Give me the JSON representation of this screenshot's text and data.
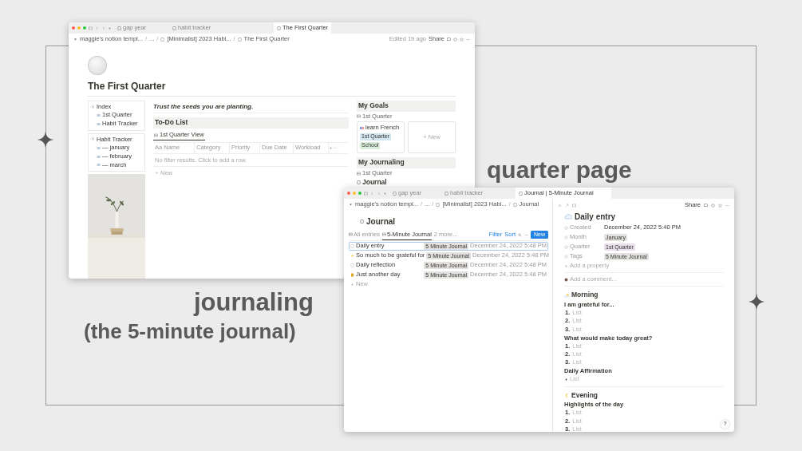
{
  "captions": [
    {
      "text": "quarter page"
    },
    {
      "text": "journaling"
    },
    {
      "text": "(the 5-minute journal)"
    }
  ],
  "quarter_window": {
    "tabs": [
      {
        "label": "gap year",
        "selected": false
      },
      {
        "label": "habit tracker",
        "selected": false
      },
      {
        "label": "The First Quarter",
        "selected": true
      }
    ],
    "breadcrumbs": [
      "maggie's notion templ...",
      "...",
      "[Minimalist] 2023 Habi...",
      "The First Quarter"
    ],
    "separator": "/",
    "edited": "Edited 1h ago",
    "share": "Share",
    "title": "The First Quarter",
    "sidebar": [
      {
        "title": "Index",
        "items": [
          "1st Quarter",
          "Habit Tracker"
        ]
      },
      {
        "title": "Habit Tracker",
        "items": [
          "— january",
          "— february",
          "— march"
        ]
      }
    ],
    "quote": "Trust the seeds you are planting.",
    "todo": {
      "title": "To-Do List",
      "view": "1st Quarter View",
      "columns": [
        "Aa Name",
        "Category",
        "Priority",
        "Due Date",
        "Workload"
      ],
      "empty": "No filter results. Click to add a row.",
      "new": "New"
    },
    "goals": {
      "title": "My Goals",
      "view": "1st Quarter",
      "cards": [
        {
          "title": "learn French",
          "tags": [
            {
              "label": "1st Quarter",
              "color": "#d3e5ef"
            },
            {
              "label": "School",
              "color": "#dbeddb"
            }
          ]
        }
      ],
      "new": "+ New"
    },
    "journaling": {
      "title": "My Journaling",
      "view": "1st Quarter",
      "database": "Journal"
    }
  },
  "journal_window": {
    "tabs": [
      {
        "label": "gap year",
        "selected": false
      },
      {
        "label": "habit tracker",
        "selected": false
      },
      {
        "label": "Journal | 5-Minute Journal",
        "selected": true
      }
    ],
    "breadcrumbs": [
      "maggie's notion templ...",
      "...",
      "[Minimalist] 2023 Habi...",
      "Journal"
    ],
    "separator": "/",
    "title": "Journal",
    "views": [
      {
        "label": "All entries",
        "selected": false
      },
      {
        "label": "5-Minute Journal",
        "selected": true
      },
      {
        "label": "2 more...",
        "selected": false
      }
    ],
    "actions": [
      "Filter",
      "Sort"
    ],
    "new": "New",
    "rows": [
      {
        "name": "Daily entry",
        "tag": "5 Minute Journal",
        "date": "December 24, 2022 5:48 PM",
        "selected": true
      },
      {
        "name": "So much to be grateful for",
        "tag": "5 Minute Journal",
        "date": "December 24, 2022 5:48 PM",
        "selected": false
      },
      {
        "name": "Daily reflection",
        "tag": "5 Minute Journal",
        "date": "December 24, 2022 5:48 PM",
        "selected": false
      },
      {
        "name": "Just another day",
        "tag": "5 Minute Journal",
        "date": "December 24, 2022 5:48 PM",
        "selected": false
      }
    ],
    "add_row": "New",
    "entry": {
      "share": "Share",
      "title": "Daily entry",
      "properties": [
        {
          "name": "Created",
          "kind": "text",
          "value": "December 24, 2022 5:40 PM"
        },
        {
          "name": "Month",
          "kind": "tag",
          "value": "January",
          "color": "#e3e2e0"
        },
        {
          "name": "Quarter",
          "kind": "tag",
          "value": "1st Quarter",
          "color": "#e8deee"
        },
        {
          "name": "Tags",
          "kind": "tag",
          "value": "5 Minute Journal",
          "color": "#e3e2e0"
        }
      ],
      "add_property": "Add a property",
      "comment_placeholder": "Add a comment...",
      "sections": [
        {
          "title": "Morning",
          "kind": "day",
          "blocks": [
            {
              "heading": "I am grateful for...",
              "kind": "numbered",
              "items": [
                {
                  "marker": "1.",
                  "text": "List"
                },
                {
                  "marker": "2.",
                  "text": "List"
                },
                {
                  "marker": "3.",
                  "text": "List"
                }
              ]
            },
            {
              "heading": "What would make today great?",
              "kind": "numbered",
              "items": [
                {
                  "marker": "1.",
                  "text": "List"
                },
                {
                  "marker": "2.",
                  "text": "List"
                },
                {
                  "marker": "3.",
                  "text": "List"
                }
              ]
            },
            {
              "heading": "Daily Affirmation",
              "kind": "bulleted",
              "items": [
                {
                  "text": "List"
                }
              ]
            }
          ]
        },
        {
          "title": "Evening",
          "kind": "night",
          "blocks": [
            {
              "heading": "Highlights of the day",
              "kind": "numbered",
              "items": [
                {
                  "marker": "1.",
                  "text": "List"
                },
                {
                  "marker": "2.",
                  "text": "List"
                },
                {
                  "marker": "3.",
                  "text": "List"
                }
              ]
            }
          ]
        }
      ]
    },
    "help": "?"
  }
}
